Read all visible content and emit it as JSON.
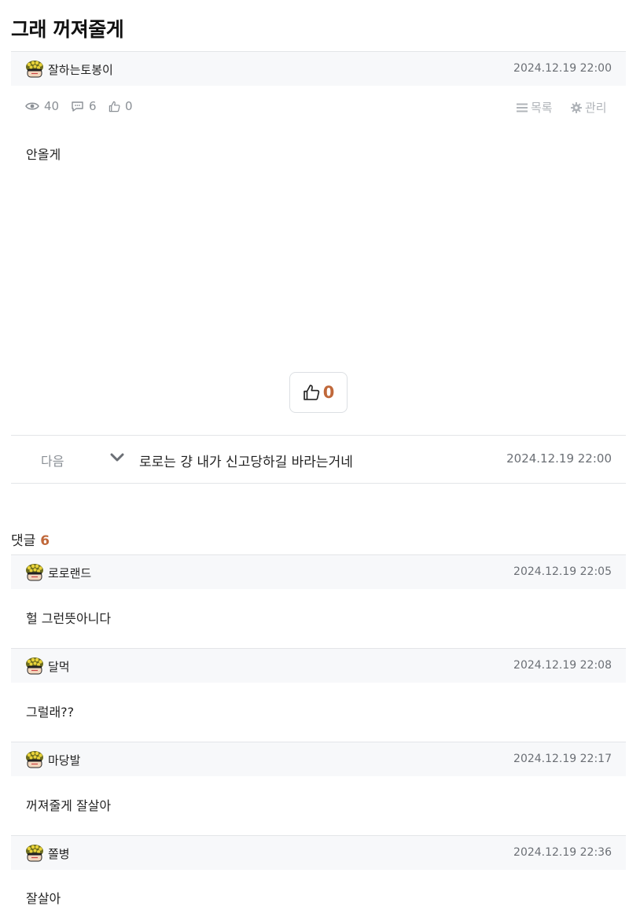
{
  "post": {
    "title": "그래 꺼져줄게",
    "author": "잘하는토봉이",
    "date": "2024.12.19 22:00",
    "views": "40",
    "comments": "6",
    "likes": "0",
    "list_label": "목록",
    "manage_label": "관리",
    "body": "안올게",
    "like_button_count": "0"
  },
  "next_post": {
    "label": "다음",
    "title": "로로는 걍 내가 신고당하길 바라는거네",
    "date": "2024.12.19 22:00"
  },
  "comments_section": {
    "label": "댓글",
    "count": "6",
    "items": [
      {
        "author": "로로랜드",
        "date": "2024.12.19 22:05",
        "text": "헐 그런뜻아니다"
      },
      {
        "author": "달먹",
        "date": "2024.12.19 22:08",
        "text": "그럴래??"
      },
      {
        "author": "마당발",
        "date": "2024.12.19 22:17",
        "text": "꺼져줄게 잘살아"
      },
      {
        "author": "쫄병",
        "date": "2024.12.19 22:36",
        "text": "잘살아"
      }
    ]
  },
  "icons": [
    "eye-icon",
    "comment-icon",
    "thumbs-up-icon",
    "list-icon",
    "gear-icon",
    "chevron-down-icon",
    "avatar-icon"
  ],
  "colors": {
    "accent": "#c0683a",
    "bar_bg": "#f7f8fa",
    "muted": "#8a8f95"
  }
}
